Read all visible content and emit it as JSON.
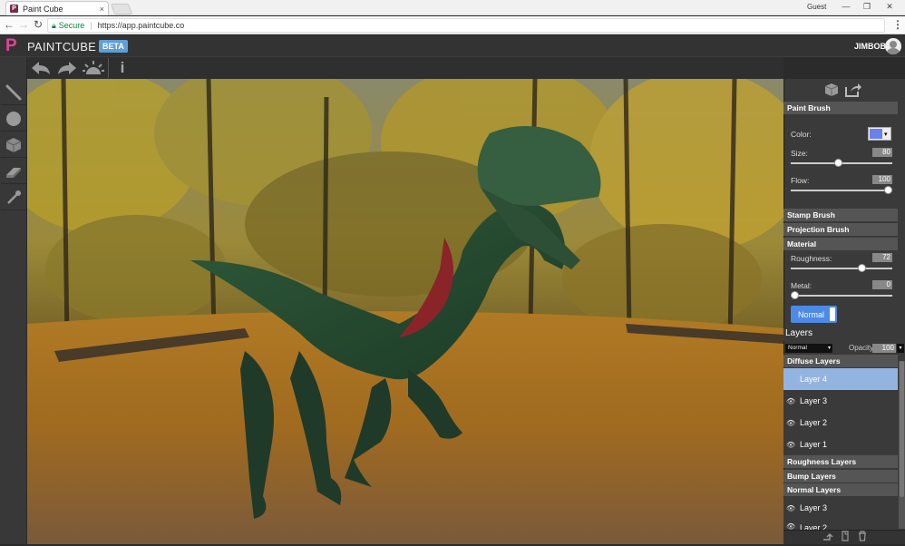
{
  "browser": {
    "tab_title": "Paint Cube",
    "tab_close": "×",
    "favicon_letter": "P",
    "profile": "Guest",
    "secure_label": "Secure",
    "url": "https://app.paintcube.co",
    "back": "←",
    "forward": "→",
    "reload": "↻",
    "menu": "⋮",
    "minimize": "—",
    "restore": "❐",
    "close": "✕"
  },
  "app": {
    "logo_letter": "P",
    "brand": "PAINTCUBE",
    "beta_badge": "BETA",
    "username": "JIMBOB"
  },
  "top_toolbar": {
    "info_label": "i"
  },
  "left_tools": [
    "paint-brush-tool",
    "stamp-tool",
    "projection-tool",
    "eraser-tool",
    "eyedropper-tool"
  ],
  "panel": {
    "paint_brush": {
      "header": "Paint Brush",
      "color_label": "Color:",
      "color_value": "#6b7ff0",
      "color_arrow": "▾",
      "size_label": "Size:",
      "size_value": "80",
      "size_fraction": 0.47,
      "flow_label": "Flow:",
      "flow_value": "100",
      "flow_fraction": 1.0
    },
    "stamp_brush": "Stamp Brush",
    "projection_brush": "Projection Brush",
    "material": {
      "header": "Material",
      "roughness_label": "Roughness:",
      "roughness_value": "72",
      "roughness_fraction": 0.72,
      "metal_label": "Metal:",
      "metal_value": "0",
      "metal_fraction": 0.0,
      "normal_button": "Normal"
    },
    "layers": {
      "header": "Layers",
      "blend_mode": "Normal",
      "blend_arrow": "▾",
      "opacity_label": "Opacity:",
      "opacity_value": "100",
      "diffuse_header": "Diffuse Layers",
      "diffuse": [
        {
          "name": "Layer 4",
          "selected": true
        },
        {
          "name": "Layer 3",
          "selected": false
        },
        {
          "name": "Layer 2",
          "selected": false
        },
        {
          "name": "Layer 1",
          "selected": false
        }
      ],
      "roughness_header": "Roughness Layers",
      "bump_header": "Bump Layers",
      "normal_header": "Normal Layers",
      "normal": [
        {
          "name": "Layer 3"
        },
        {
          "name": "Layer 2"
        }
      ],
      "eye_glyph": "👁"
    }
  },
  "colors": {
    "accent": "#4c8ae8",
    "selected_layer": "#93b4e0",
    "brand_pink": "#e04596",
    "beta_blue": "#5d9fd6"
  }
}
